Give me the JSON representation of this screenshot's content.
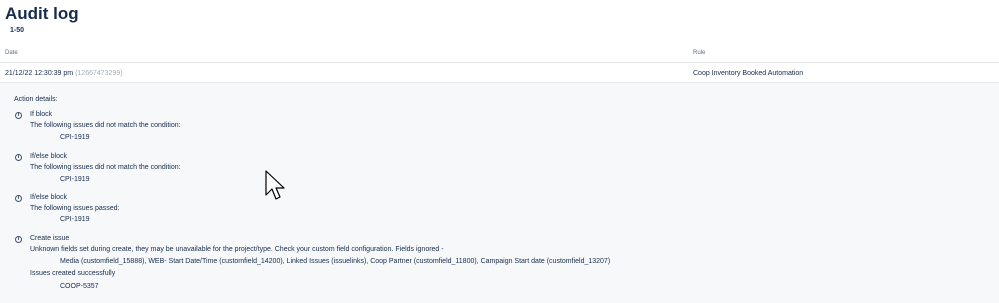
{
  "page": {
    "title": "Audit log",
    "range": "1-50"
  },
  "columns": {
    "date": "Date",
    "rule": "Rule"
  },
  "entry": {
    "date": "21/12/22 12:30:39 pm",
    "id": "(12667473299)",
    "rule": "Coop Inventory Booked Automation"
  },
  "details": {
    "heading": "Action details:",
    "actions": [
      {
        "title": "If block",
        "message": "The following issues did not match the condition:",
        "item": "CPI-1919"
      },
      {
        "title": "If/else block",
        "message": "The following issues did not match the condition:",
        "item": "CPI-1919"
      },
      {
        "title": "If/else block",
        "message": "The following issues passed:",
        "item": "CPI-1919"
      },
      {
        "title": "Create issue",
        "message": "Unknown fields set during create, they may be unavailable for the project/type. Check your custom field configuration. Fields ignored -",
        "fields": "Media (customfield_15888), WEB- Start Date/Time (customfield_14200), Linked Issues (issuelinks), Coop Partner (customfield_11800), Campaign Start date (customfield_13207)",
        "result": "Issues created successfully",
        "item": "COOP-5357"
      }
    ]
  },
  "icons": {
    "info": "info-icon",
    "cursor": "mouse-pointer-icon"
  }
}
